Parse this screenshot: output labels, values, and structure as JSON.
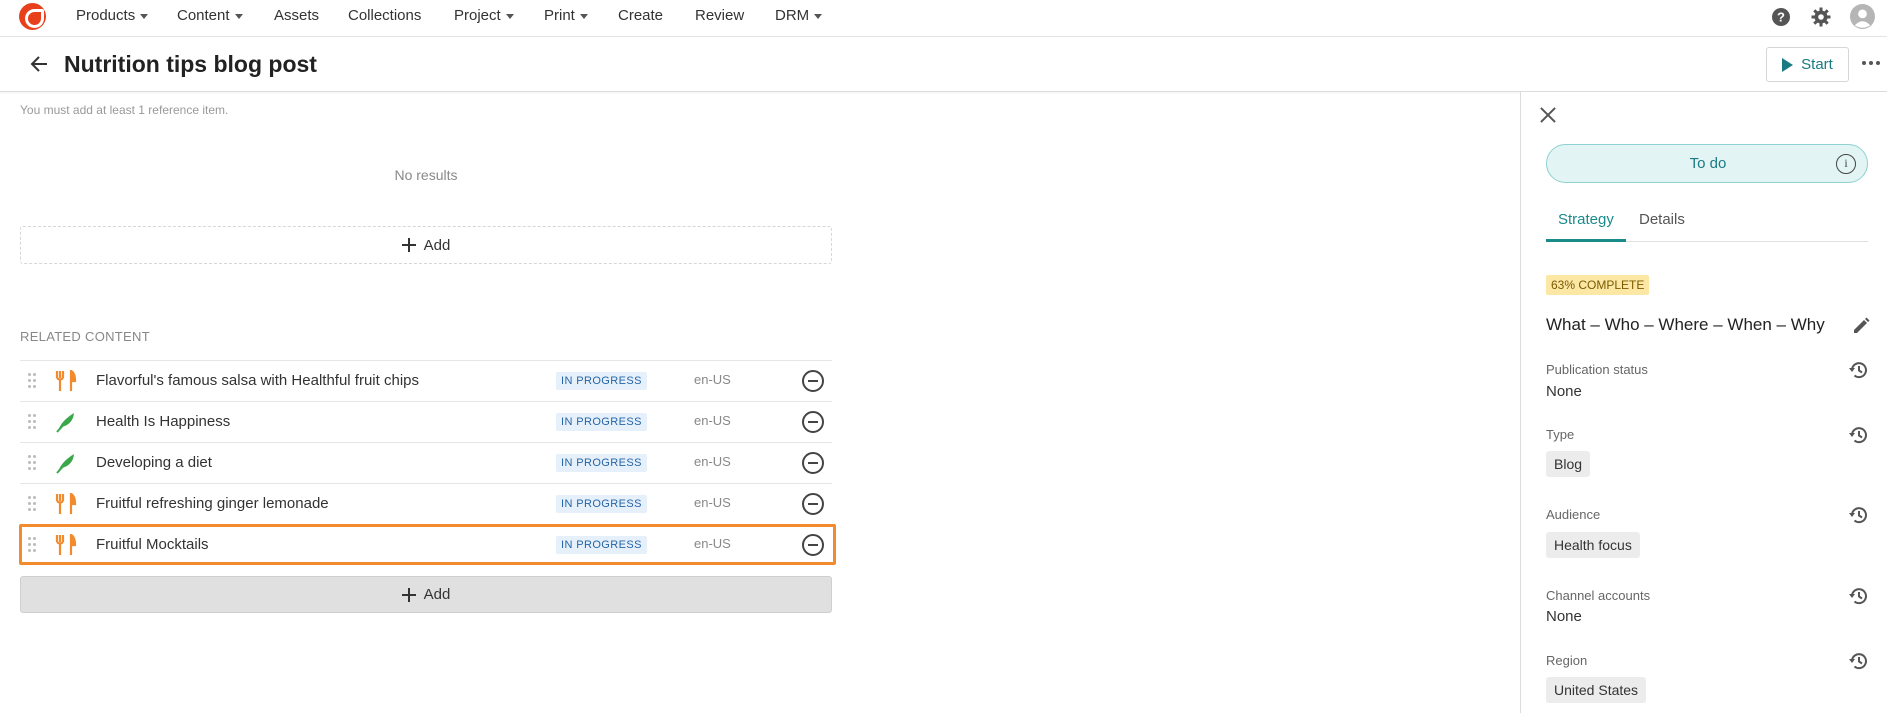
{
  "nav": {
    "items": [
      {
        "label": "Products",
        "caret": true
      },
      {
        "label": "Content",
        "caret": true
      },
      {
        "label": "Assets",
        "caret": false
      },
      {
        "label": "Collections",
        "caret": false
      },
      {
        "label": "Project",
        "caret": true
      },
      {
        "label": "Print",
        "caret": true
      },
      {
        "label": "Create",
        "caret": false
      },
      {
        "label": "Review",
        "caret": false
      },
      {
        "label": "DRM",
        "caret": true
      }
    ]
  },
  "header": {
    "title": "Nutrition tips blog post",
    "start_label": "Start"
  },
  "main": {
    "hint": "You must add at least 1 reference item.",
    "no_results": "No results",
    "add_label": "Add",
    "related_title": "RELATED CONTENT",
    "related_items": [
      {
        "title": "Flavorful's famous salsa with Healthful fruit chips",
        "icon": "fork-knife-icon",
        "status": "IN PROGRESS",
        "locale": "en-US"
      },
      {
        "title": "Health Is Happiness",
        "icon": "feather-icon",
        "status": "IN PROGRESS",
        "locale": "en-US"
      },
      {
        "title": "Developing a diet",
        "icon": "feather-icon",
        "status": "IN PROGRESS",
        "locale": "en-US"
      },
      {
        "title": "Fruitful refreshing ginger lemonade",
        "icon": "fork-knife-icon",
        "status": "IN PROGRESS",
        "locale": "en-US"
      },
      {
        "title": "Fruitful Mocktails",
        "icon": "fork-knife-icon",
        "status": "IN PROGRESS",
        "locale": "en-US"
      }
    ],
    "add_bottom_label": "Add"
  },
  "panel": {
    "state": "To do",
    "tabs": [
      "Strategy",
      "Details"
    ],
    "complete": "63% COMPLETE",
    "strategy": "What – Who – Where – When – Why",
    "fields": {
      "publication_status": {
        "label": "Publication status",
        "value": "None"
      },
      "type": {
        "label": "Type",
        "value": "Blog"
      },
      "audience": {
        "label": "Audience",
        "value": "Health focus"
      },
      "channel_accounts": {
        "label": "Channel accounts",
        "value": "None"
      },
      "region": {
        "label": "Region",
        "value": "United States"
      }
    }
  },
  "colors": {
    "accent": "#1a7a82",
    "highlight": "#f28a2e",
    "recipe_icon": "#f28a2e",
    "article_icon": "#3aa84a"
  }
}
